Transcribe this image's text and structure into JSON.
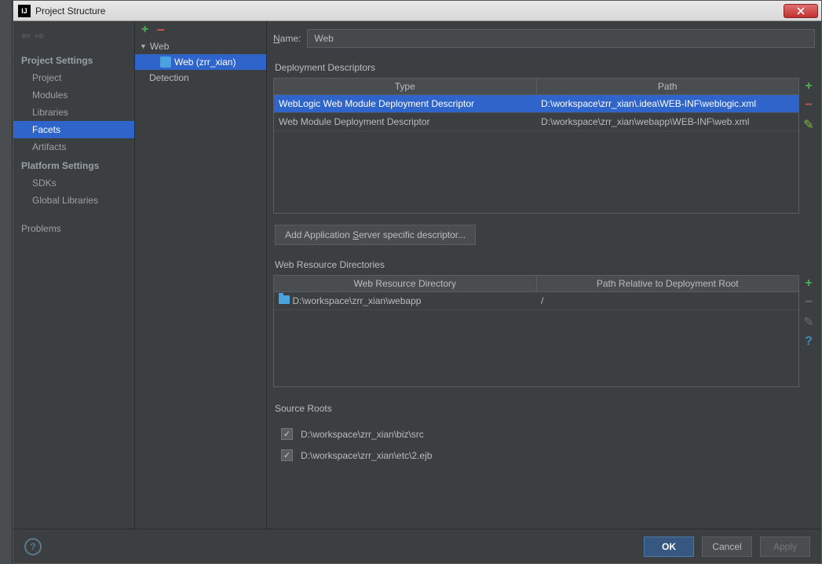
{
  "titlebar": {
    "title": "Project Structure"
  },
  "leftnav": {
    "section1": "Project Settings",
    "items1": [
      "Project",
      "Modules",
      "Libraries",
      "Facets",
      "Artifacts"
    ],
    "selected1": "Facets",
    "section2": "Platform Settings",
    "items2": [
      "SDKs",
      "Global Libraries"
    ],
    "problems": "Problems"
  },
  "tree": {
    "root": "Web",
    "child": "Web (zrr_xian)",
    "detection": "Detection"
  },
  "detail": {
    "name_label": "Name:",
    "name_value": "Web",
    "dep_label": "Deployment Descriptors",
    "dep_headers": [
      "Type",
      "Path"
    ],
    "dep_rows": [
      {
        "type": "WebLogic Web Module Deployment Descriptor",
        "path": "D:\\workspace\\zrr_xian\\.idea\\WEB-INF\\weblogic.xml",
        "sel": true
      },
      {
        "type": "Web Module Deployment Descriptor",
        "path": "D:\\workspace\\zrr_xian\\webapp\\WEB-INF\\web.xml",
        "sel": false
      }
    ],
    "add_descriptor_btn": "Add Application Server specific descriptor...",
    "wrd_label": "Web Resource Directories",
    "wrd_headers": [
      "Web Resource Directory",
      "Path Relative to Deployment Root"
    ],
    "wrd_rows": [
      {
        "dir": "D:\\workspace\\zrr_xian\\webapp",
        "rel": "/"
      }
    ],
    "src_label": "Source Roots",
    "src_roots": [
      "D:\\workspace\\zrr_xian\\biz\\src",
      "D:\\workspace\\zrr_xian\\etc\\2.ejb"
    ]
  },
  "buttons": {
    "ok": "OK",
    "cancel": "Cancel",
    "apply": "Apply"
  }
}
